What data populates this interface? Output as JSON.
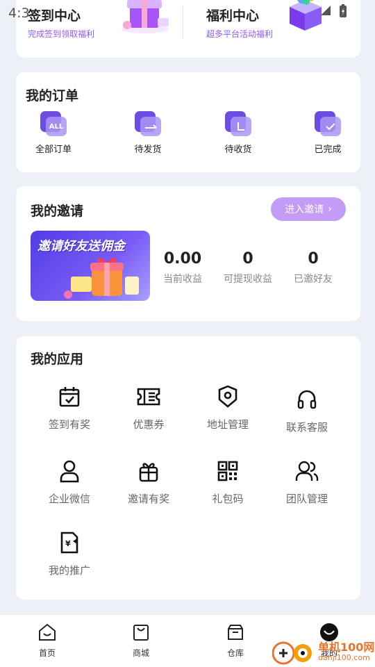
{
  "status_bar": {
    "time": "4:3"
  },
  "welfare": {
    "left": {
      "title": "签到中心",
      "subtitle": "完成签到领取福利"
    },
    "right": {
      "title": "福利中心",
      "subtitle": "超多平台活动福利"
    }
  },
  "orders": {
    "title": "我的订单",
    "items": [
      {
        "label": "全部订单",
        "icon_text": "ALL"
      },
      {
        "label": "待发货",
        "icon_text": ""
      },
      {
        "label": "待收货",
        "icon_text": ""
      },
      {
        "label": "已完成",
        "icon_text": ""
      }
    ]
  },
  "invite": {
    "title": "我的邀请",
    "button": "进入邀请",
    "banner_text": "邀请好友送佣金",
    "stats": [
      {
        "value": "0.00",
        "label": "当前收益"
      },
      {
        "value": "0",
        "label": "可提现收益"
      },
      {
        "value": "0",
        "label": "已邀好友"
      }
    ]
  },
  "apps": {
    "title": "我的应用",
    "items": [
      {
        "label": "签到有奖",
        "icon": "calendar-check-icon"
      },
      {
        "label": "优惠券",
        "icon": "coupon-icon"
      },
      {
        "label": "地址管理",
        "icon": "location-icon"
      },
      {
        "label": "联系客服",
        "icon": "headset-icon"
      },
      {
        "label": "企业微信",
        "icon": "person-icon"
      },
      {
        "label": "邀请有奖",
        "icon": "gift-icon"
      },
      {
        "label": "礼包码",
        "icon": "qrcode-icon"
      },
      {
        "label": "团队管理",
        "icon": "team-icon"
      },
      {
        "label": "我的推广",
        "icon": "promotion-icon"
      }
    ]
  },
  "nav": {
    "items": [
      {
        "label": "首页",
        "icon": "home-icon"
      },
      {
        "label": "商城",
        "icon": "shopping-bag-icon"
      },
      {
        "label": "仓库",
        "icon": "warehouse-icon"
      },
      {
        "label": "我的",
        "icon": "profile-icon"
      }
    ]
  },
  "watermark": {
    "text": "单机100网",
    "url": "danji100.com"
  },
  "colors": {
    "accent": "#8b5cf6",
    "button": "#c39cf7",
    "icon_dark": "#6d4de0"
  }
}
